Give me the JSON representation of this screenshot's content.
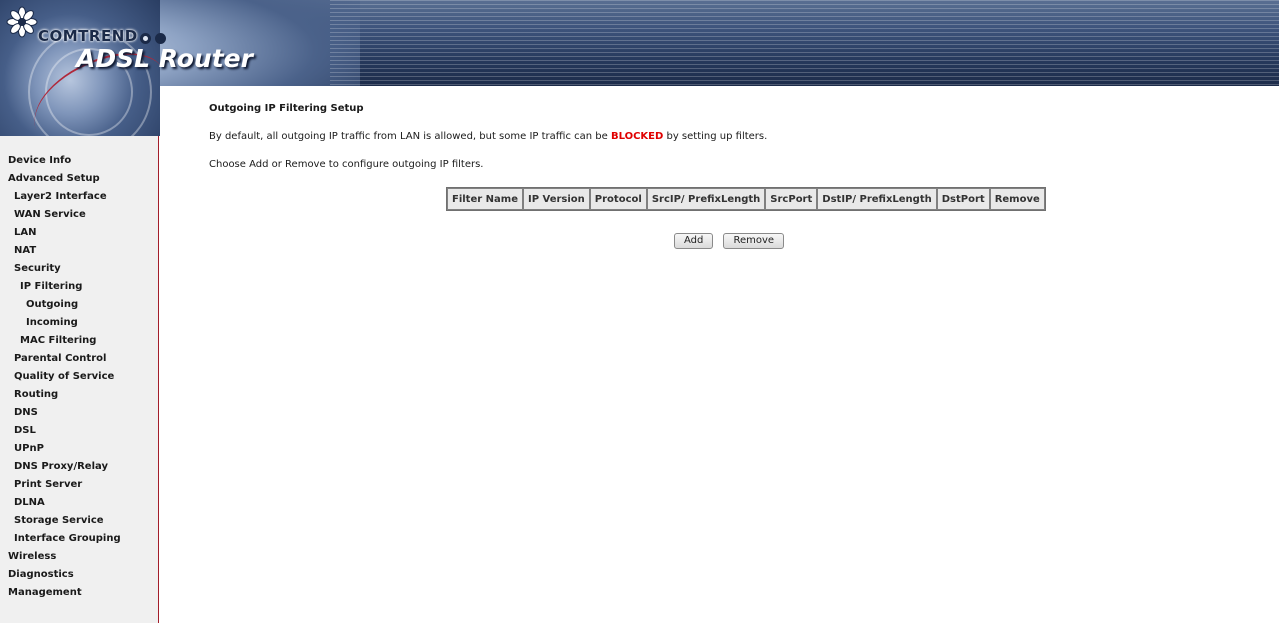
{
  "header": {
    "brand": "COMTREND",
    "product": "ADSL Router",
    "icons": [
      "flower-logo-icon"
    ]
  },
  "sidebar": {
    "items": [
      {
        "label": "Device Info",
        "level": 0
      },
      {
        "label": "Advanced Setup",
        "level": 0
      },
      {
        "label": "Layer2 Interface",
        "level": 1
      },
      {
        "label": "WAN Service",
        "level": 1
      },
      {
        "label": "LAN",
        "level": 1
      },
      {
        "label": "NAT",
        "level": 1
      },
      {
        "label": "Security",
        "level": 1
      },
      {
        "label": "IP Filtering",
        "level": 2
      },
      {
        "label": "Outgoing",
        "level": 3
      },
      {
        "label": "Incoming",
        "level": 3
      },
      {
        "label": "MAC Filtering",
        "level": 2
      },
      {
        "label": "Parental Control",
        "level": 1
      },
      {
        "label": "Quality of Service",
        "level": 1
      },
      {
        "label": "Routing",
        "level": 1
      },
      {
        "label": "DNS",
        "level": 1
      },
      {
        "label": "DSL",
        "level": 1
      },
      {
        "label": "UPnP",
        "level": 1
      },
      {
        "label": "DNS Proxy/Relay",
        "level": 1
      },
      {
        "label": "Print Server",
        "level": 1
      },
      {
        "label": "DLNA",
        "level": 1
      },
      {
        "label": "Storage Service",
        "level": 1
      },
      {
        "label": "Interface Grouping",
        "level": 1
      },
      {
        "label": "Wireless",
        "level": 0
      },
      {
        "label": "Diagnostics",
        "level": 0
      },
      {
        "label": "Management",
        "level": 0
      }
    ]
  },
  "main": {
    "title": "Outgoing IP Filtering Setup",
    "desc_before": "By default, all outgoing IP traffic from LAN is allowed, but some IP traffic can be ",
    "desc_blocked": "BLOCKED",
    "desc_after": " by setting up filters.",
    "instructions": "Choose Add or Remove to configure outgoing IP filters.",
    "table_columns": [
      "Filter Name",
      "IP Version",
      "Protocol",
      "SrcIP/ PrefixLength",
      "SrcPort",
      "DstIP/ PrefixLength",
      "DstPort",
      "Remove"
    ],
    "add_label": "Add",
    "remove_label": "Remove"
  },
  "colors": {
    "blocked": "#e00000",
    "sidebar_border": "#a31d2a",
    "sidebar_bg": "#f0f0f0"
  }
}
